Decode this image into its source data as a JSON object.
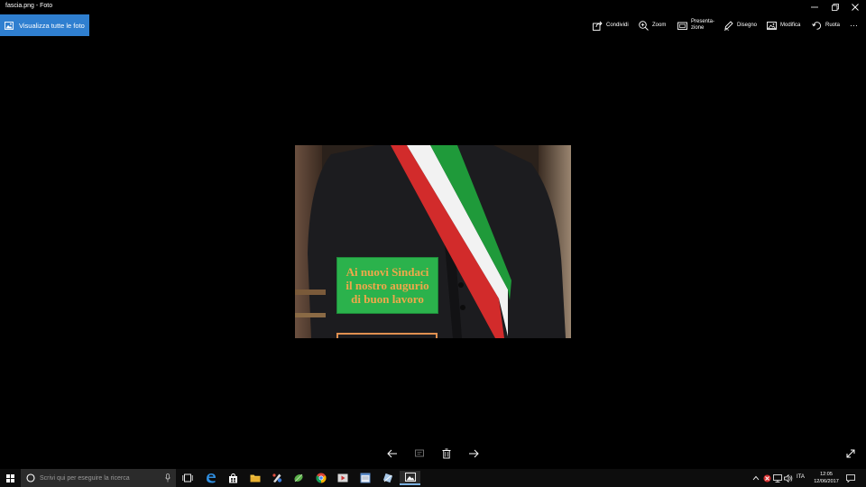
{
  "window": {
    "title": "fascia.png - Foto"
  },
  "toolbar": {
    "view_all": "Visualizza tutte le foto",
    "share": "Condividi",
    "zoom": "Zoom",
    "slideshow": "Presenta-zione",
    "draw": "Disegno",
    "edit": "Modifica",
    "rotate": "Ruota",
    "more": "···"
  },
  "photo": {
    "caption": [
      "Ai nuovi Sindaci",
      "il nostro augurio",
      "di buon lavoro"
    ]
  },
  "taskbar": {
    "search_placeholder": "Scrivi qui per eseguire la ricerca",
    "language": "ITA",
    "time": "12:05",
    "date": "12/06/2017"
  },
  "colors": {
    "accent": "#2f7fd0",
    "caption_bg": "#2bb24c",
    "caption_text": "#f0a84a",
    "flag_green": "#1f9a3a",
    "flag_white": "#f2f2f2",
    "flag_red": "#d22b2b"
  }
}
